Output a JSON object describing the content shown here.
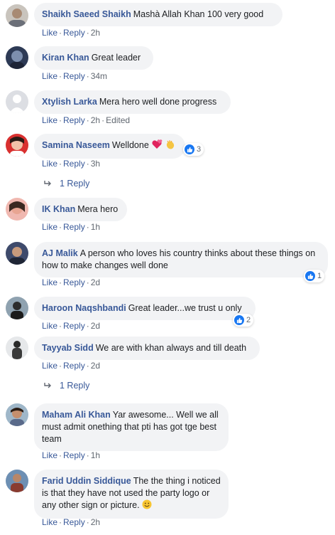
{
  "labels": {
    "like": "Like",
    "reply": "Reply",
    "dot": "·"
  },
  "comments": [
    {
      "author": "Shaikh Saeed Shaikh",
      "text": "Mashà Allah Khan 100 very good",
      "time": "2h",
      "edited": ""
    },
    {
      "author": "Kiran Khan",
      "text": "Great leader",
      "time": "34m",
      "edited": ""
    },
    {
      "author": "Xtylish Larka",
      "text": "Mera hero well done progress",
      "time": "2h",
      "edited": "Edited"
    },
    {
      "author": "Samina Naseem",
      "text": "Welldone",
      "time": "3h",
      "edited": "",
      "reactions": "3",
      "replies": "1 Reply"
    },
    {
      "author": "IK Khan",
      "text": "Mera hero",
      "time": "1h",
      "edited": ""
    },
    {
      "author": "AJ Malik",
      "text": "A person who loves his country thinks about these things on how to make changes well done",
      "time": "2d",
      "edited": "",
      "reactions": "1"
    },
    {
      "author": "Haroon Naqshbandi",
      "text": "Great leader...we trust u only",
      "time": "2d",
      "edited": "",
      "reactions": "2"
    },
    {
      "author": "Tayyab Sidd",
      "text": "We are with khan always and till death",
      "time": "2d",
      "edited": "",
      "replies": "1 Reply"
    },
    {
      "author": "Maham Ali Khan",
      "text": "Yar awesome... Well we all must admit onething that pti has got tge best team",
      "time": "1h",
      "edited": ""
    },
    {
      "author": "Farid Uddin Siddique",
      "text": "The the thing i noticed is that they have not used the party logo or any other sign or picture.",
      "time": "2h",
      "edited": ""
    }
  ],
  "colors": {
    "name": "#385898",
    "bubble": "#f2f3f5",
    "meta": "#606770",
    "like_blue": "#1877f2"
  }
}
